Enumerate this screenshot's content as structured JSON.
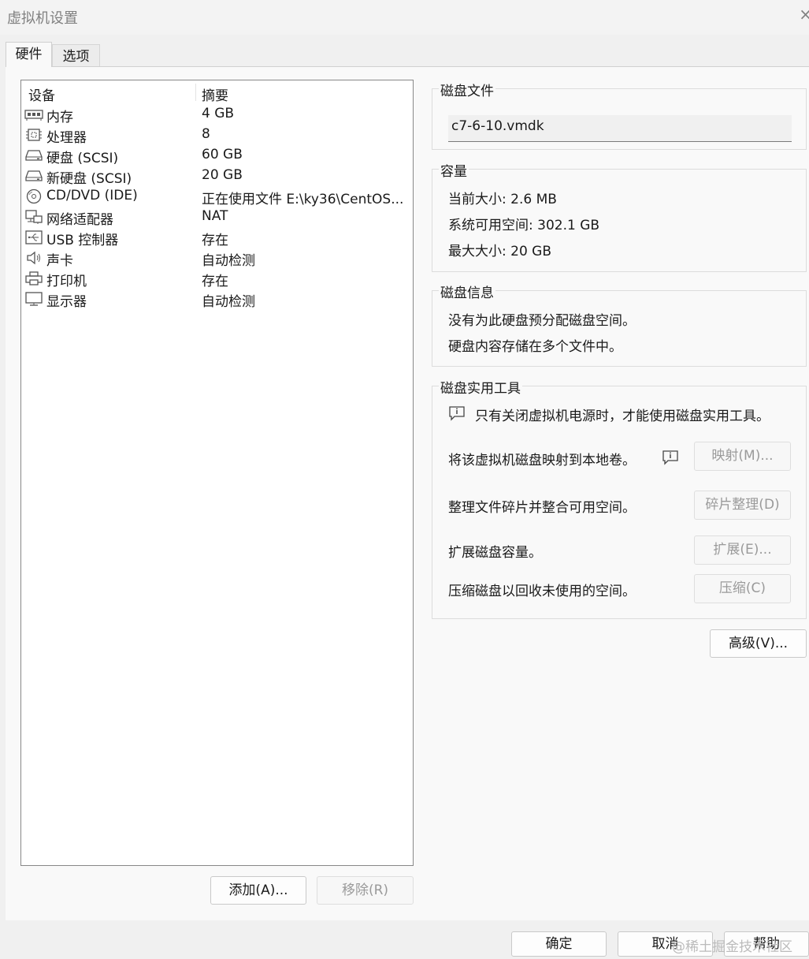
{
  "window": {
    "title": "虚拟机设置",
    "close_glyph": "×"
  },
  "tabs": [
    {
      "label": "硬件"
    },
    {
      "label": "选项"
    }
  ],
  "device_list": {
    "headers": {
      "device": "设备",
      "summary": "摘要"
    },
    "rows": [
      {
        "name": "内存",
        "summary": "4 GB",
        "icon": "memory-icon"
      },
      {
        "name": "处理器",
        "summary": "8",
        "icon": "processor-icon"
      },
      {
        "name": "硬盘 (SCSI)",
        "summary": "60 GB",
        "icon": "hard-disk-icon"
      },
      {
        "name": "新硬盘 (SCSI)",
        "summary": "20 GB",
        "icon": "hard-disk-icon"
      },
      {
        "name": "CD/DVD (IDE)",
        "summary": "正在使用文件 E:\\ky36\\CentOS...",
        "icon": "cd-dvd-icon"
      },
      {
        "name": "网络适配器",
        "summary": "NAT",
        "icon": "network-adapter-icon"
      },
      {
        "name": "USB 控制器",
        "summary": "存在",
        "icon": "usb-icon"
      },
      {
        "name": "声卡",
        "summary": "自动检测",
        "icon": "speaker-icon"
      },
      {
        "name": "打印机",
        "summary": "存在",
        "icon": "printer-icon"
      },
      {
        "name": "显示器",
        "summary": "自动检测",
        "icon": "monitor-icon"
      }
    ]
  },
  "list_buttons": {
    "add": "添加(A)...",
    "remove": "移除(R)"
  },
  "disk_file": {
    "title": "磁盘文件",
    "value": "c7-6-10.vmdk"
  },
  "capacity": {
    "title": "容量",
    "current_size": "当前大小: 2.6 MB",
    "system_free": "系统可用空间: 302.1 GB",
    "max_size": "最大大小: 20 GB"
  },
  "disk_info": {
    "title": "磁盘信息",
    "line1": "没有为此硬盘预分配磁盘空间。",
    "line2": "硬盘内容存储在多个文件中。"
  },
  "disk_utilities": {
    "title": "磁盘实用工具",
    "notice": "只有关闭虚拟机电源时，才能使用磁盘实用工具。",
    "map_label": "将该虚拟机磁盘映射到本地卷。",
    "map_button": "映射(M)...",
    "defrag_label": "整理文件碎片并整合可用空间。",
    "defrag_button": "碎片整理(D)",
    "expand_label": "扩展磁盘容量。",
    "expand_button": "扩展(E)...",
    "compact_label": "压缩磁盘以回收未使用的空间。",
    "compact_button": "压缩(C)"
  },
  "advanced_button": "高级(V)...",
  "footer": {
    "ok": "确定",
    "cancel": "取消",
    "help": "帮助"
  },
  "watermark": "@稀土掘金技术社区"
}
